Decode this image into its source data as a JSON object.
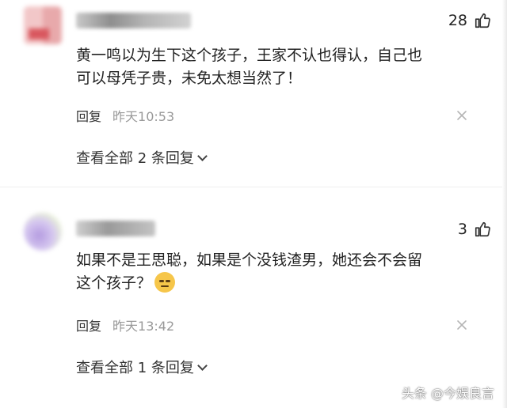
{
  "comments": [
    {
      "likes": "28",
      "text_line1": "黄一鸣以为生下这个孩子，王家不认也得认，自己也",
      "text_line2": "可以母凭子贵，未免太想当然了！",
      "reply_label": "回复",
      "time": "昨天10:53",
      "view_replies": "查看全部 2 条回复",
      "avatar_colors": [
        "#f2c7c8",
        "#e8a9ab",
        "#d9585f"
      ]
    },
    {
      "likes": "3",
      "text_line1": "如果不是王思聪，如果是个没钱渣男，她还会不会留",
      "text_line2": "这个孩子？",
      "emoji_icon": "unamused-face-emoji-icon",
      "reply_label": "回复",
      "time": "昨天13:42",
      "view_replies": "查看全部 1 条回复",
      "avatar_colors": [
        "#b49be0",
        "#e9f3d6"
      ]
    }
  ],
  "icons": {
    "like": "thumbs-up-icon",
    "more": "close-icon",
    "expand": "chevron-down-icon"
  },
  "watermark": "头条 @今娱良言"
}
